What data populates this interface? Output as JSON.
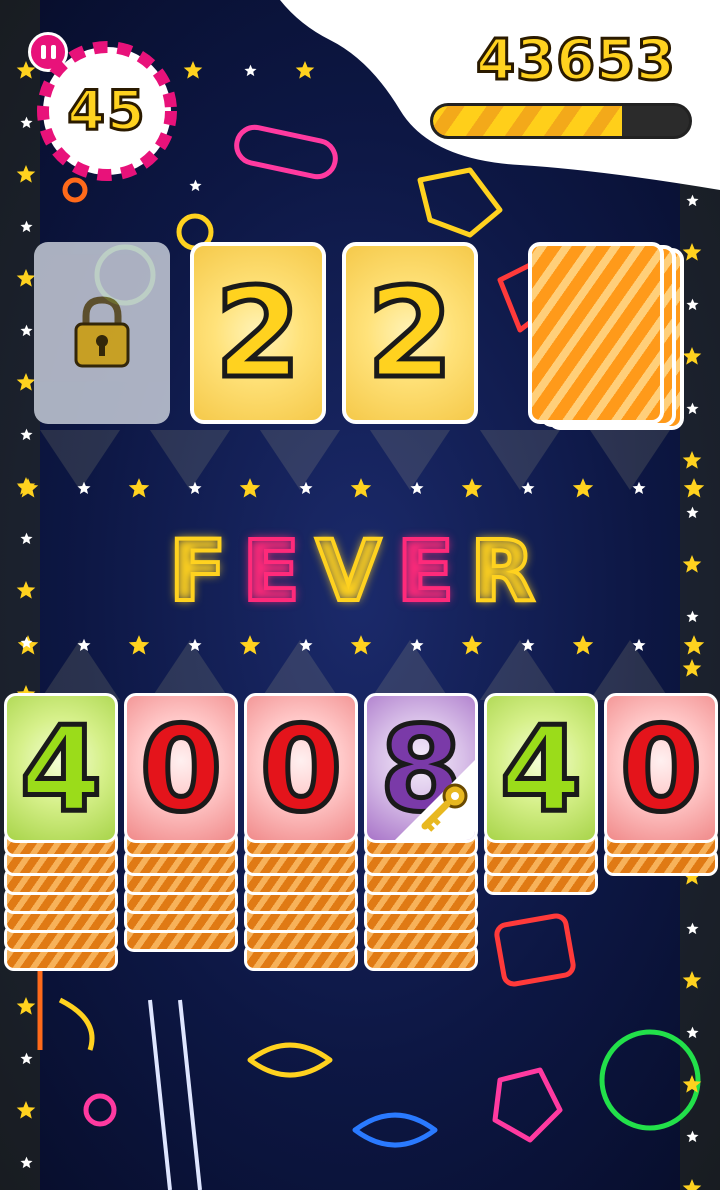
{
  "hud": {
    "timer_value": "45",
    "score": "43653",
    "fever_progress_percent": 74
  },
  "top_row": {
    "locked_slot_icon": "lock-icon",
    "cards": [
      "2",
      "2"
    ],
    "deck_icon": "card-back-stack"
  },
  "banner": {
    "letters": [
      "F",
      "E",
      "V",
      "E",
      "R"
    ],
    "colors": [
      "#ffd21f",
      "#ff2a7a",
      "#ffd21f",
      "#ff2a7a",
      "#ffd21f"
    ]
  },
  "columns": [
    {
      "value": "4",
      "color": "green",
      "hidden_cards": 7,
      "key": false
    },
    {
      "value": "0",
      "color": "red",
      "hidden_cards": 6,
      "key": false
    },
    {
      "value": "0",
      "color": "red",
      "hidden_cards": 7,
      "key": false
    },
    {
      "value": "8",
      "color": "purple",
      "hidden_cards": 7,
      "key": true
    },
    {
      "value": "4",
      "color": "green",
      "hidden_cards": 3,
      "key": false
    },
    {
      "value": "0",
      "color": "red",
      "hidden_cards": 2,
      "key": false
    }
  ],
  "colors": {
    "gold": "#ffd21f",
    "pink": "#e8127a",
    "background": "#0d1744"
  }
}
